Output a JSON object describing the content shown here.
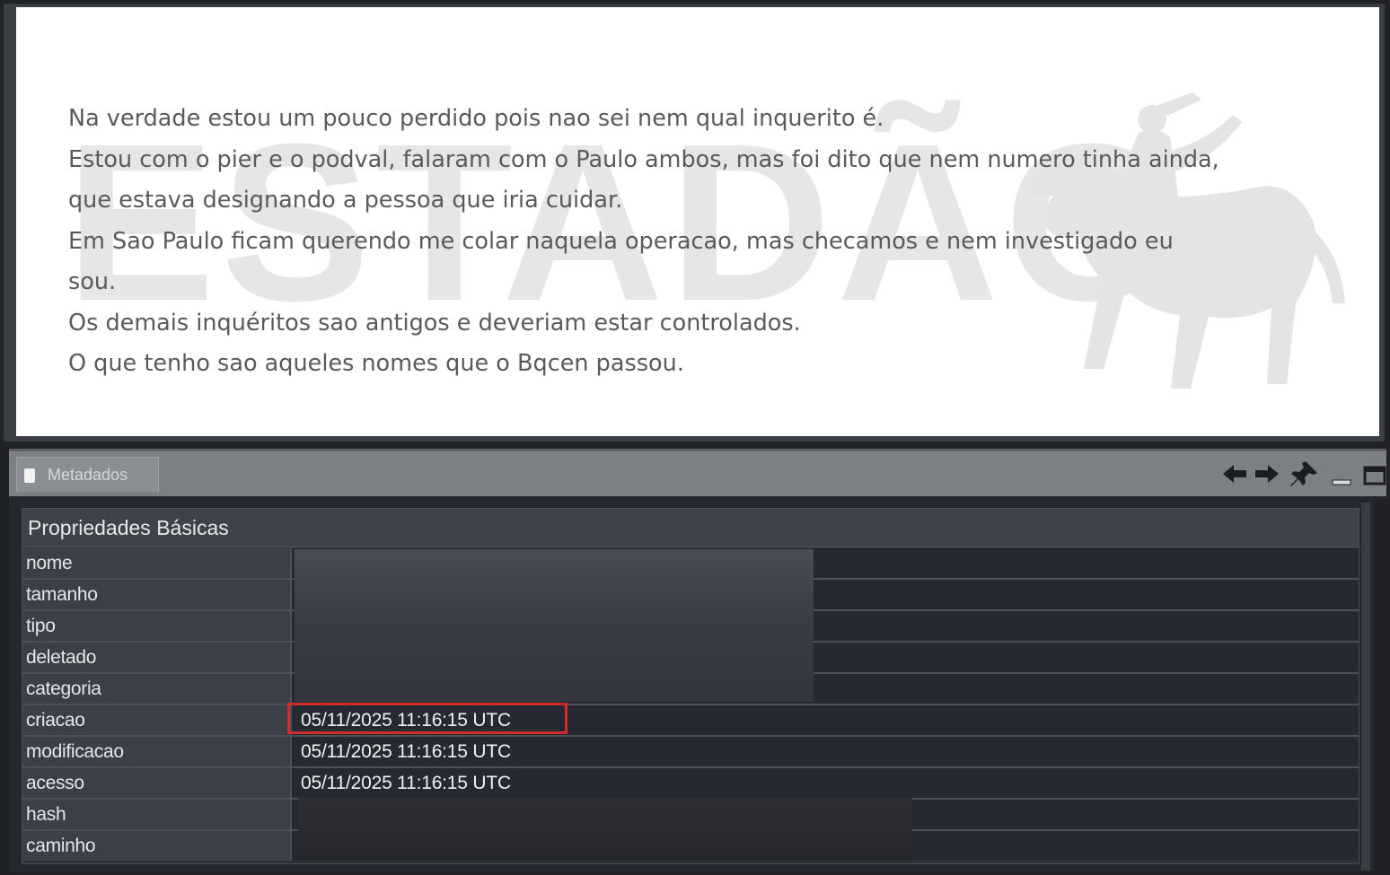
{
  "document": {
    "watermark_text": "ESTADÃO",
    "lines": [
      "Na verdade estou um pouco perdido pois nao sei nem qual inquerito é.",
      "Estou com o pier e o podval, falaram com o Paulo ambos, mas foi dito que nem numero tinha ainda,",
      "que estava designando a pessoa que iria cuidar.",
      "Em Sao Paulo ficam querendo me colar naquela operacao, mas checamos e nem investigado eu",
      "sou.",
      "Os demais inquéritos sao antigos e deveriam estar controlados.",
      "O que tenho sao aqueles nomes que o Bqcen passou."
    ]
  },
  "panel": {
    "tab_label": "Metadados",
    "icons": [
      "back-arrow-icon",
      "forward-arrow-icon",
      "pin-icon",
      "minimize-icon",
      "maximize-icon"
    ]
  },
  "properties": {
    "section_title": "Propriedades Básicas",
    "rows": [
      {
        "key": "nome",
        "value": ""
      },
      {
        "key": "tamanho",
        "value": ""
      },
      {
        "key": "tipo",
        "value": ""
      },
      {
        "key": "deletado",
        "value": ""
      },
      {
        "key": "categoria",
        "value": ""
      },
      {
        "key": "criacao",
        "value": "05/11/2025 11:16:15 UTC"
      },
      {
        "key": "modificacao",
        "value": "05/11/2025 11:16:15 UTC"
      },
      {
        "key": "acesso",
        "value": "05/11/2025 11:16:15 UTC"
      },
      {
        "key": "hash",
        "value": ""
      },
      {
        "key": "caminho",
        "value": ""
      }
    ]
  },
  "colors": {
    "highlight": "#d42a2a",
    "watermark": "#e6e6e6",
    "message_text": "#5a5a5a"
  }
}
